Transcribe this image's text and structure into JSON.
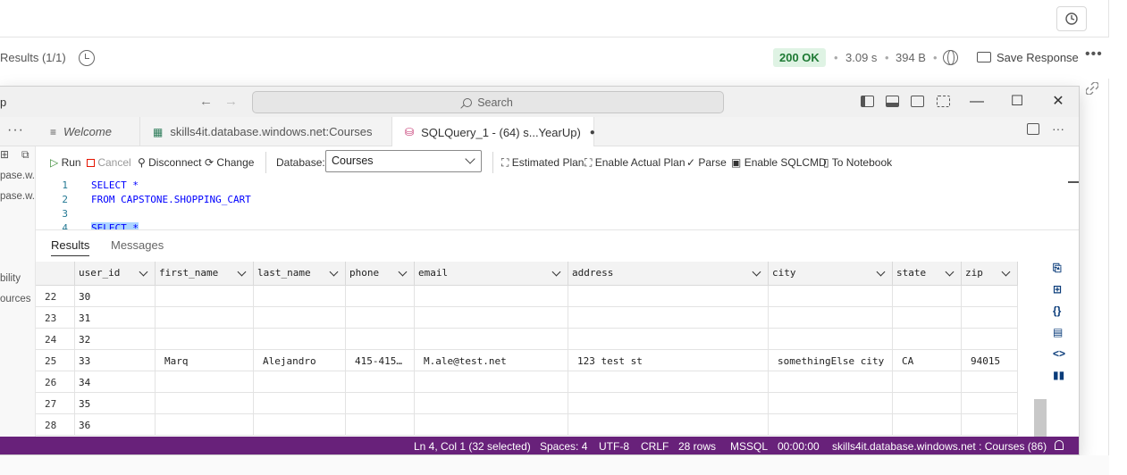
{
  "background_app": {
    "results_label": "Results (1/1)",
    "status_code": "200 OK",
    "time": "3.09 s",
    "size": "394 B",
    "save_response": "Save Response",
    "dot": "•",
    "more": "•••"
  },
  "window": {
    "title_fragment": "p",
    "search_placeholder": "Search",
    "sidebar_more": "···"
  },
  "tabs": [
    {
      "label": "Welcome"
    },
    {
      "label": "skills4it.database.windows.net:Courses"
    },
    {
      "label": "SQLQuery_1 - (64) s...YearUp)"
    }
  ],
  "toolbar": {
    "run": "Run",
    "cancel": "Cancel",
    "disconnect": "Disconnect",
    "change": "Change",
    "database_label": "Database:",
    "database_value": "Courses",
    "estimated_plan": "Estimated Plan",
    "actual_plan": "Enable Actual Plan",
    "parse": "Parse",
    "sqlcmd": "Enable SQLCMD",
    "notebook": "To Notebook"
  },
  "sidebar": {
    "items": [
      "pase.w...",
      "pase.w...",
      "bility",
      "ources"
    ]
  },
  "editor": {
    "lines": [
      {
        "num": "1",
        "text": "SELECT *"
      },
      {
        "num": "2",
        "text": "FROM CAPSTONE.SHOPPING_CART"
      },
      {
        "num": "3",
        "text": ""
      },
      {
        "num": "4",
        "text": "SELECT *"
      }
    ]
  },
  "results_tabs": {
    "results": "Results",
    "messages": "Messages"
  },
  "grid": {
    "columns": [
      "user_id",
      "first_name",
      "last_name",
      "phone",
      "email",
      "address",
      "city",
      "state",
      "zip"
    ],
    "rows": [
      {
        "row": "22",
        "user_id": "30",
        "first_name": "",
        "last_name": "",
        "phone": "",
        "email": "",
        "address": "",
        "city": "",
        "state": "",
        "zip": ""
      },
      {
        "row": "23",
        "user_id": "31",
        "first_name": "",
        "last_name": "",
        "phone": "",
        "email": "",
        "address": "",
        "city": "",
        "state": "",
        "zip": ""
      },
      {
        "row": "24",
        "user_id": "32",
        "first_name": "",
        "last_name": "",
        "phone": "",
        "email": "",
        "address": "",
        "city": "",
        "state": "",
        "zip": ""
      },
      {
        "row": "25",
        "user_id": "33",
        "first_name": "Marq",
        "last_name": "Alejandro",
        "phone": "415-415…",
        "email": "M.ale@test.net",
        "address": "123 test st",
        "city": "somethingElse city",
        "state": "CA",
        "zip": "94015"
      },
      {
        "row": "26",
        "user_id": "34",
        "first_name": "",
        "last_name": "",
        "phone": "",
        "email": "",
        "address": "",
        "city": "",
        "state": "",
        "zip": ""
      },
      {
        "row": "27",
        "user_id": "35",
        "first_name": "",
        "last_name": "",
        "phone": "",
        "email": "",
        "address": "",
        "city": "",
        "state": "",
        "zip": ""
      },
      {
        "row": "28",
        "user_id": "36",
        "first_name": "",
        "last_name": "",
        "phone": "",
        "email": "",
        "address": "",
        "city": "",
        "state": "",
        "zip": ""
      }
    ]
  },
  "statusbar": {
    "position": "Ln 4, Col 1 (32 selected)",
    "spaces": "Spaces: 4",
    "encoding": "UTF-8",
    "eol": "CRLF",
    "rows": "28 rows",
    "language": "MSSQL",
    "elapsed": "00:00:00",
    "connection": "skills4it.database.windows.net : Courses (86)"
  },
  "colors": {
    "statusbar": "#68217a",
    "ok_badge_bg": "#dff3e4",
    "ok_badge_text": "#1e7a34",
    "run_green": "#388a34",
    "cancel_red": "#e51400"
  }
}
